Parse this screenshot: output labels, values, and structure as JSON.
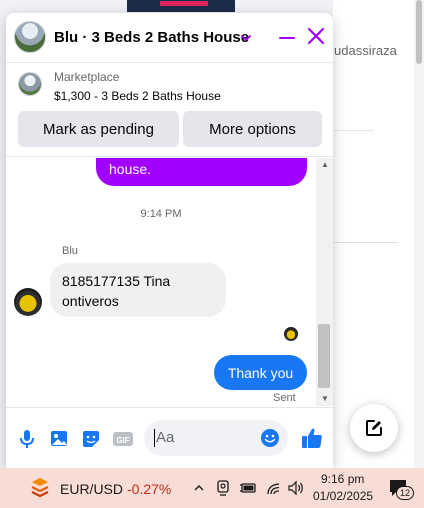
{
  "background": {
    "partial_text": "udassiraza"
  },
  "chat": {
    "title": "Blu · 3 Beds 2 Baths House",
    "accent_color": "#a100ff",
    "marketplace": {
      "label": "Marketplace",
      "listing": "$1,300 - 3 Beds 2 Baths House",
      "mark_pending_label": "Mark as pending",
      "more_options_label": "More options"
    },
    "messages": {
      "previous_bubble_tail": "house.",
      "time_separator": "9:14 PM",
      "sender_name": "Blu",
      "incoming_text": "8185177135 Tina ontiveros",
      "outgoing_text": "Thank you",
      "status": "Sent"
    },
    "composer": {
      "placeholder": "Aa",
      "gif_label": "GIF",
      "icons": [
        "microphone-icon",
        "photo-icon",
        "sticker-icon",
        "gif-icon",
        "emoji-icon",
        "like-icon"
      ]
    }
  },
  "taskbar": {
    "fx_pair": "EUR/USD",
    "fx_change": "-0.27%",
    "time": "9:16 pm",
    "date": "01/02/2025",
    "notification_count": "12"
  }
}
